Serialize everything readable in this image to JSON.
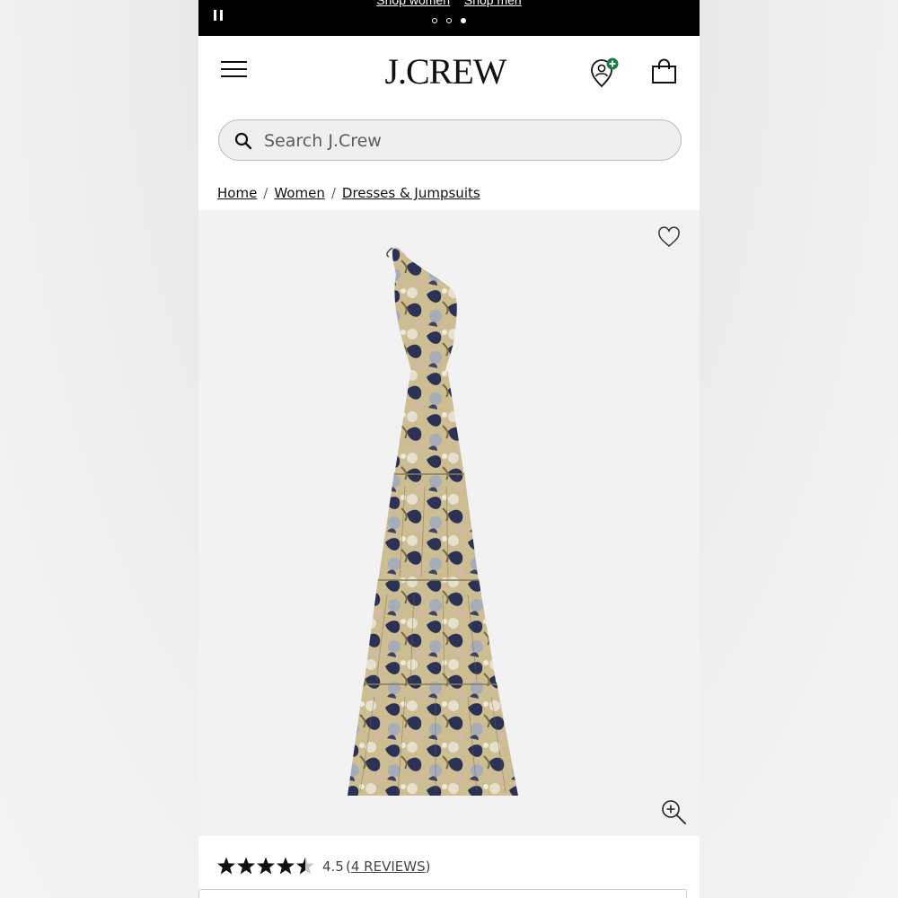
{
  "promo": {
    "links": [
      "Shop women",
      "Shop men"
    ],
    "slide_count": 3,
    "active_slide": 3
  },
  "header": {
    "logo": "J.CREW",
    "menu_icon": "hamburger-menu-icon",
    "account_icon": "account-pin-icon",
    "bag_icon": "shopping-bag-icon"
  },
  "search": {
    "placeholder": "Search J.Crew",
    "value": ""
  },
  "breadcrumb": {
    "items": [
      "Home",
      "Women",
      "Dresses & Jumpsuits"
    ],
    "separator": "/"
  },
  "product": {
    "image_icon": "dress-image",
    "wishlist_icon": "heart-icon",
    "zoom_icon": "zoom-in-icon"
  },
  "rating": {
    "stars": 4.5,
    "max": 5,
    "value_text": "4.5",
    "reviews_prefix": "(",
    "reviews_label": "4 REVIEWS",
    "reviews_suffix": ")"
  },
  "colors": {
    "promo_bg": "#000000",
    "account_badge": "#1a7a4a",
    "product_bg": "#f2f2f2"
  }
}
